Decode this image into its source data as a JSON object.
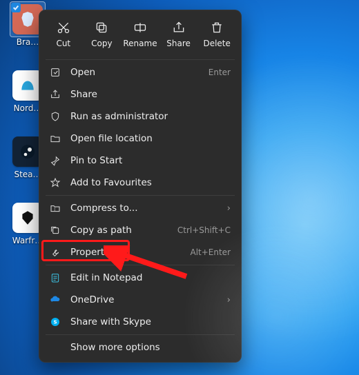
{
  "desktop": {
    "icons": [
      {
        "label": "Bra…",
        "color": "#f4511e"
      },
      {
        "label": "Nord…",
        "color": "#2aa7df"
      },
      {
        "label": "Stea…",
        "color": "#132336"
      },
      {
        "label": "Warfr…",
        "color": "#ffffff"
      }
    ]
  },
  "contextMenu": {
    "topActions": [
      {
        "label": "Cut"
      },
      {
        "label": "Copy"
      },
      {
        "label": "Rename"
      },
      {
        "label": "Share"
      },
      {
        "label": "Delete"
      }
    ],
    "groups": [
      [
        {
          "label": "Open",
          "hint": "Enter",
          "icon": "open"
        },
        {
          "label": "Share",
          "icon": "share"
        },
        {
          "label": "Run as administrator",
          "icon": "shield"
        },
        {
          "label": "Open file location",
          "icon": "folder"
        },
        {
          "label": "Pin to Start",
          "icon": "pin"
        },
        {
          "label": "Add to Favourites",
          "icon": "star"
        }
      ],
      [
        {
          "label": "Compress to...",
          "submenu": true,
          "icon": "archive"
        },
        {
          "label": "Copy as path",
          "hint": "Ctrl+Shift+C",
          "icon": "path"
        },
        {
          "label": "Properties",
          "hint": "Alt+Enter",
          "icon": "wrench",
          "highlighted": true
        }
      ],
      [
        {
          "label": "Edit in Notepad",
          "icon": "notepad"
        },
        {
          "label": "OneDrive",
          "submenu": true,
          "icon": "onedrive"
        },
        {
          "label": "Share with Skype",
          "icon": "skype"
        }
      ],
      [
        {
          "label": "Show more options",
          "icon": "none"
        }
      ]
    ]
  }
}
